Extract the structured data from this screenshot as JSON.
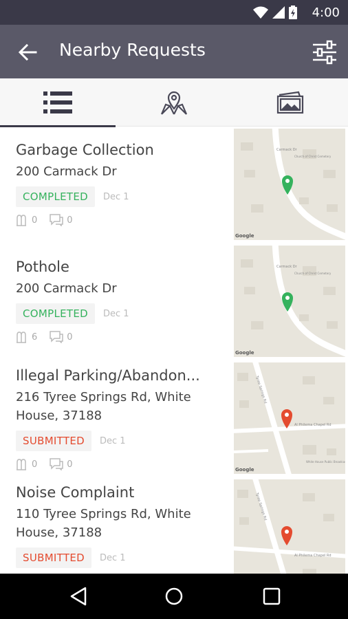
{
  "status_bar": {
    "time": "4:00"
  },
  "app_bar": {
    "title": "Nearby Requests"
  },
  "tabs": [
    {
      "name": "list",
      "selected": true
    },
    {
      "name": "map",
      "selected": false
    },
    {
      "name": "gallery",
      "selected": false
    }
  ],
  "colors": {
    "completed": "#35b25d",
    "submitted": "#e44b2f",
    "app_bar": "#5a5968",
    "status_bar": "#3a3948"
  },
  "requests": [
    {
      "title": "Garbage Collection",
      "address": "200  Carmack Dr",
      "status": "COMPLETED",
      "date": "Dec 1",
      "supports": "0",
      "comments": "0"
    },
    {
      "title": "Pothole",
      "address": "200  Carmack Dr",
      "status": "COMPLETED",
      "date": "Dec 1",
      "supports": "6",
      "comments": "0"
    },
    {
      "title": "Illegal Parking/Abandon...",
      "address": "216  Tyree Springs Rd, White House, 37188",
      "status": "SUBMITTED",
      "date": "Dec 1",
      "supports": "0",
      "comments": "0"
    },
    {
      "title": "Noise Complaint",
      "address": "110  Tyree Springs Rd, White House, 37188",
      "status": "SUBMITTED",
      "date": "Dec 1",
      "supports": "",
      "comments": ""
    }
  ]
}
